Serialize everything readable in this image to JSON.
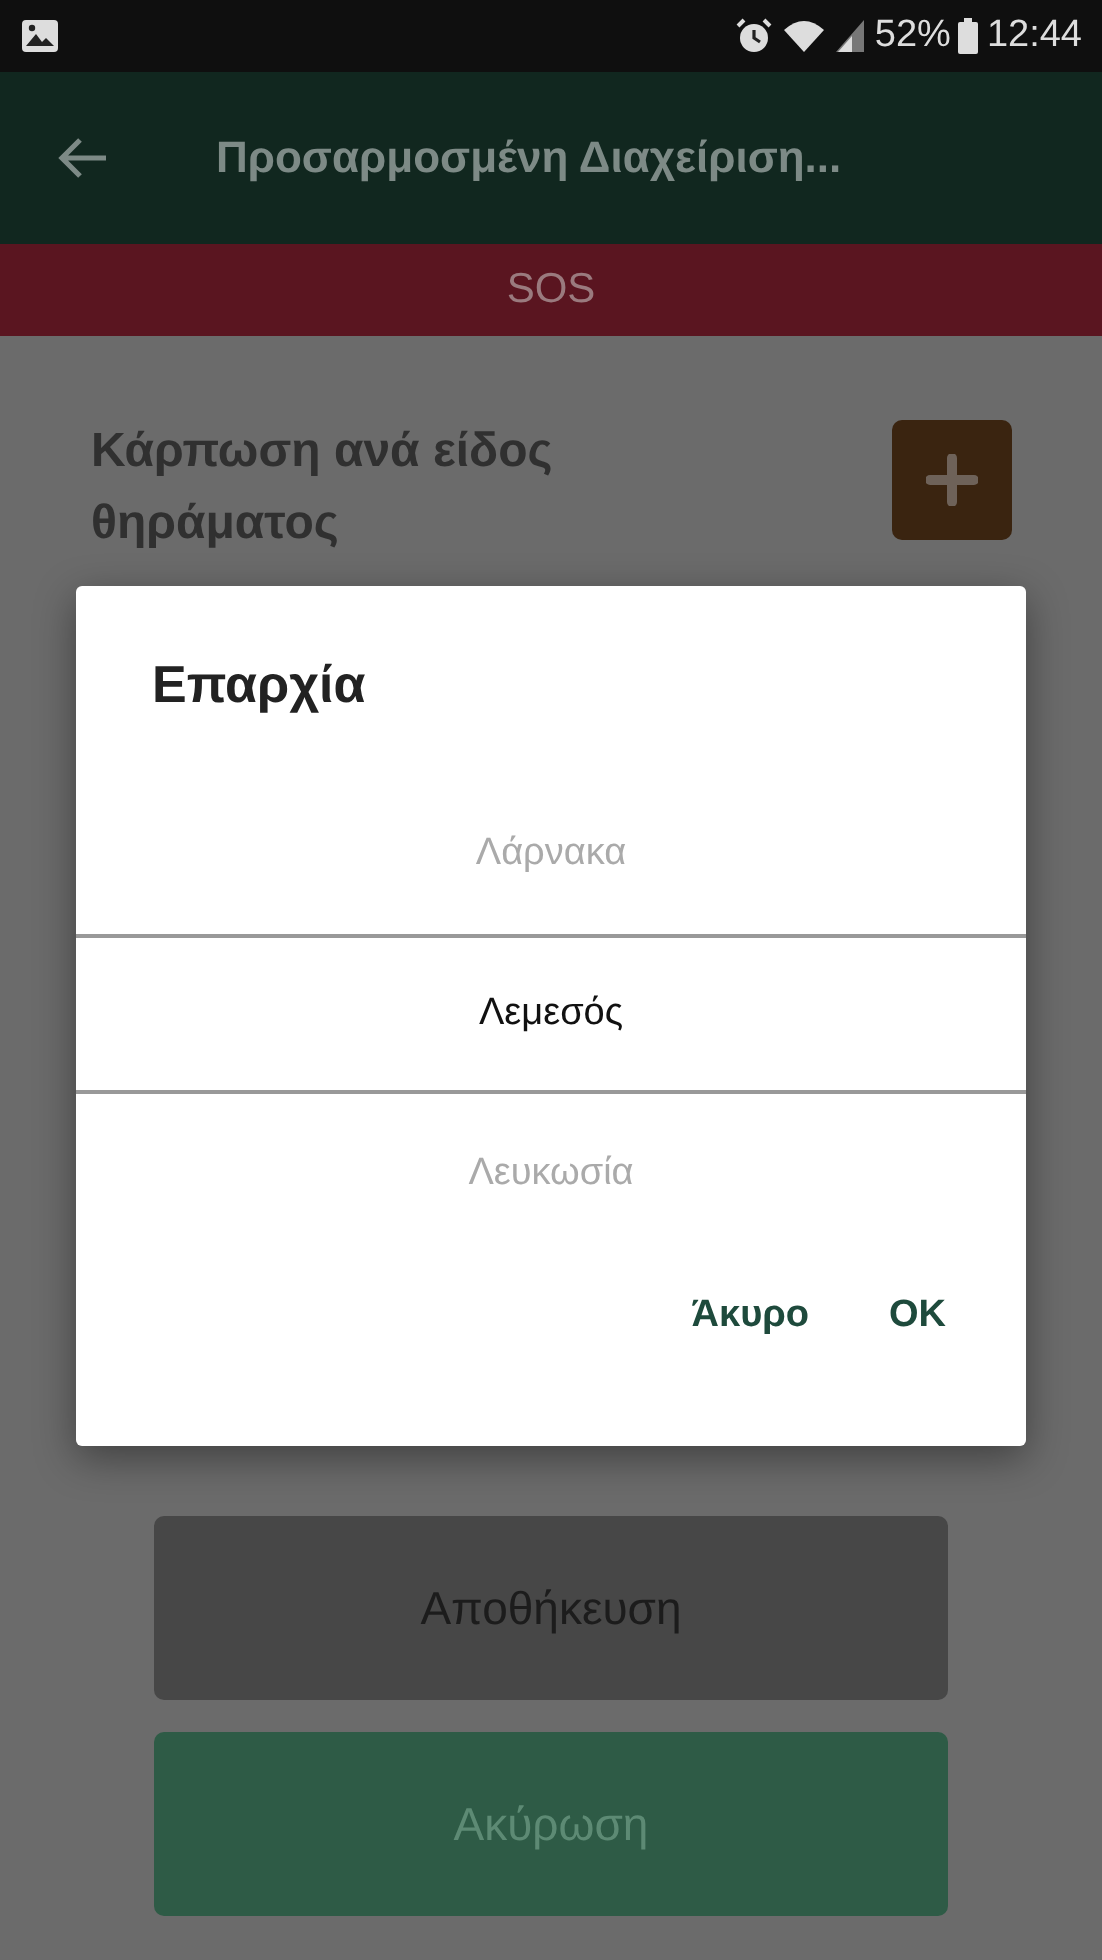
{
  "status_bar": {
    "battery": "52%",
    "time": "12:44"
  },
  "toolbar": {
    "title": "Προσαρμοσμένη Διαχείριση..."
  },
  "sos_bar": {
    "label": "SOS"
  },
  "section": {
    "title": "Κάρπωση ανά είδος θηράματος"
  },
  "buttons": [
    {
      "label": "Αποθήκευση",
      "kind": "save"
    },
    {
      "label": "Ακύρωση",
      "kind": "cancel"
    }
  ],
  "dialog": {
    "title": "Επαρχία",
    "options": [
      {
        "label": "Λάρνακα",
        "selected": false
      },
      {
        "label": "Λεμεσός",
        "selected": true
      },
      {
        "label": "Λευκωσία",
        "selected": false
      }
    ],
    "actions": [
      "Άκυρο",
      "OK"
    ]
  }
}
